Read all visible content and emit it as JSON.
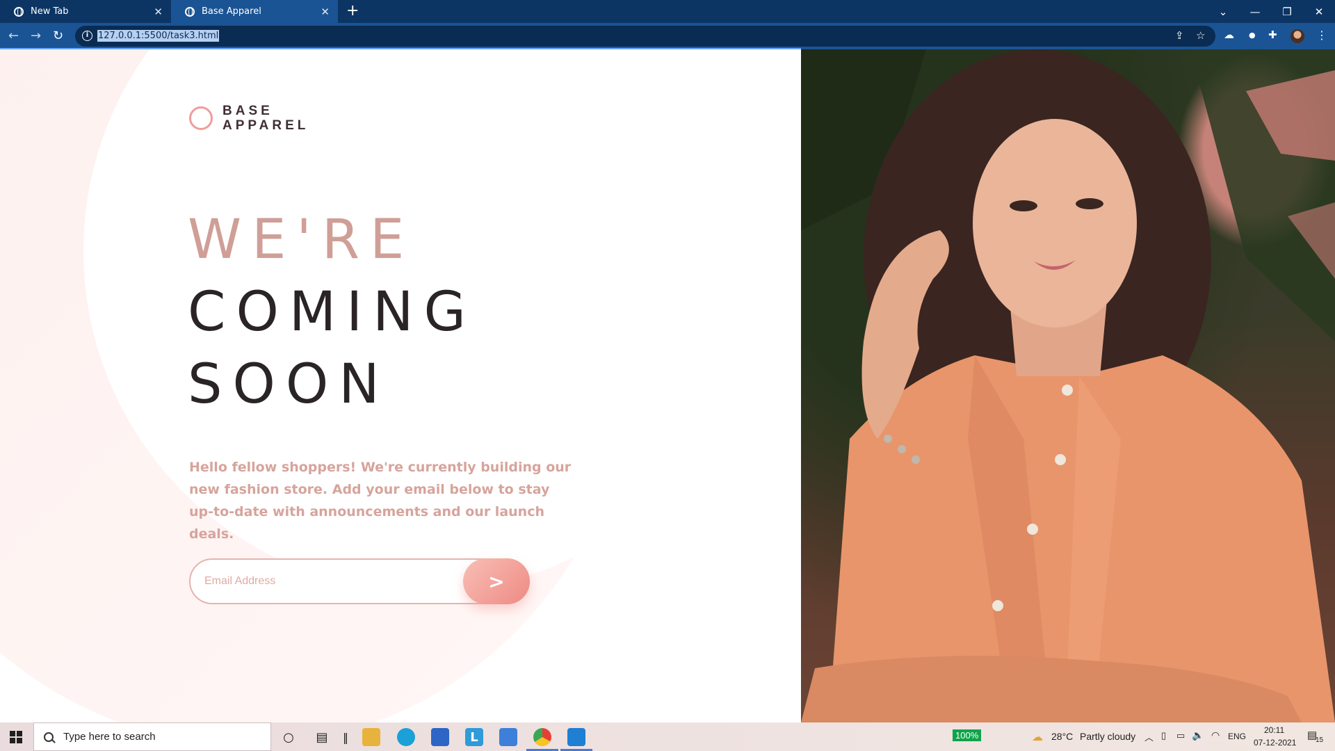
{
  "browser": {
    "tabs": [
      {
        "title": "New Tab",
        "active": false
      },
      {
        "title": "Base Apparel",
        "active": true
      }
    ],
    "new_tab_symbol": "+",
    "close_symbol": "✕",
    "window_controls": {
      "chevron": "⌄",
      "minimize": "—",
      "restore": "❐",
      "close": "✕"
    },
    "nav": {
      "back": "←",
      "forward": "→",
      "reload": "↻"
    },
    "url": "127.0.0.1:5500/task3.html",
    "omnibox_icons": [
      "info-icon",
      "share-icon",
      "star-icon"
    ],
    "toolbar_icons": [
      "cloud-icon",
      "extension-dot-icon",
      "puzzle-icon",
      "profile-avatar",
      "menu-dots-icon"
    ]
  },
  "page": {
    "logo": {
      "line1": "BASE",
      "line2": "APPAREL"
    },
    "heading": {
      "line1": "WE'RE",
      "line2": "COMING",
      "line3": "SOON"
    },
    "intro": "Hello fellow shoppers! We're currently building our new fashion store. Add your email below to stay up-to-date with announcements and our launch deals.",
    "email": {
      "placeholder": "Email Address",
      "value": "",
      "submit_label": ">"
    },
    "colors": {
      "accent": "#ef9d9b",
      "heading_light": "#cf9f97",
      "heading_dark": "#2a2427",
      "text": "#d6a49c"
    }
  },
  "taskbar": {
    "search_placeholder": "Type here to search",
    "battery": "100%",
    "weather": {
      "temp": "28°C",
      "condition": "Partly cloudy"
    },
    "language": "ENG",
    "time": "20:11",
    "date": "07-12-2021",
    "notifications": "15"
  }
}
